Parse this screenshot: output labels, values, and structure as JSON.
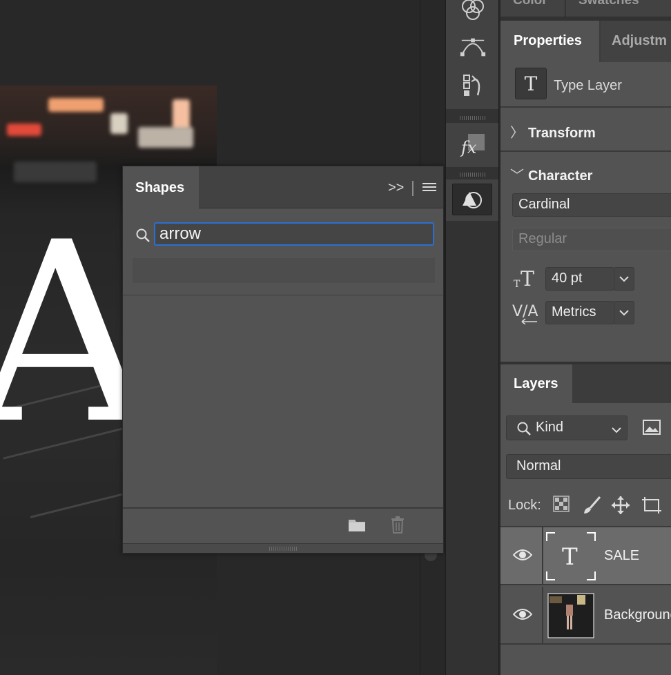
{
  "canvas": {
    "letters": "AE"
  },
  "shapes_panel": {
    "title": "Shapes",
    "search_value": "arrow",
    "collapse_glyph": ">>"
  },
  "properties_panel": {
    "tabs": [
      "Properties",
      "Adjustm"
    ],
    "layer_kind": "Type Layer",
    "sections": {
      "transform": "Transform",
      "character": "Character"
    },
    "font_family": "Cardinal",
    "font_style": "Regular",
    "font_size": "40 pt",
    "kerning": "Metrics"
  },
  "top_tabs": [
    "Color",
    "Swatches"
  ],
  "layers_panel": {
    "title": "Layers",
    "filter": "Kind",
    "blend_mode": "Normal",
    "lock_label": "Lock:",
    "layers": [
      {
        "name": "SALE",
        "type": "text",
        "visible": true,
        "selected": true
      },
      {
        "name": "Background",
        "type": "image",
        "visible": true,
        "selected": false
      }
    ]
  },
  "colors": {
    "accent": "#2c6fd2",
    "panel": "#535353",
    "canvas": "#282828"
  }
}
